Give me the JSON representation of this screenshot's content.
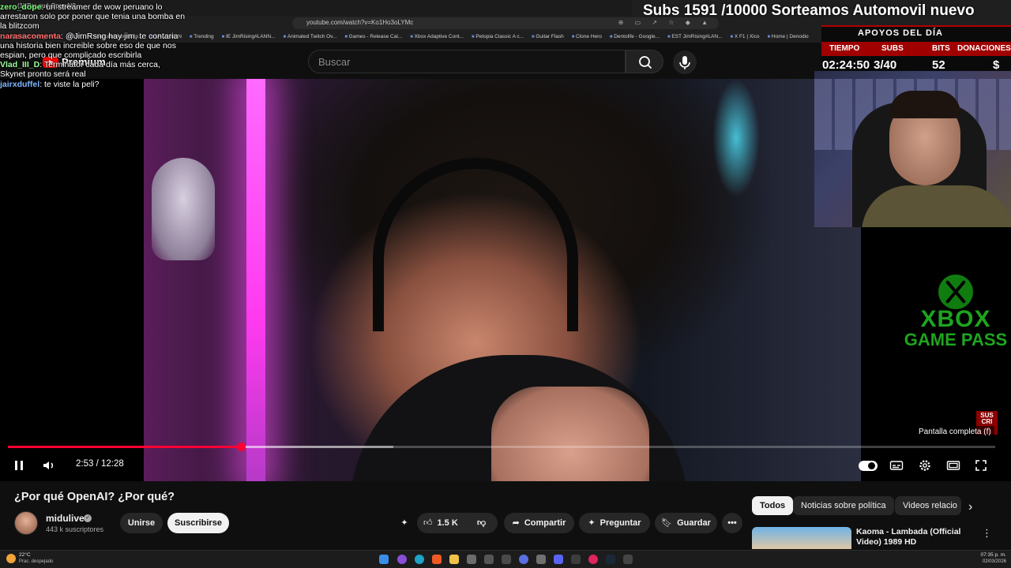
{
  "browser": {
    "tab_title": "(1) Por qué OpenAI?...",
    "url": "youtube.com/watch?v=Ko1Ho3oLYMc",
    "bookmarks": [
      "(1) Nihil Young - Ult...",
      "tryn",
      "Formulario sin título...",
      "LA LEGION",
      "Trending",
      "IE JimRising#LANN...",
      "Animated Twitch Ov...",
      "Games - Release Cal...",
      "Xbox Adaptive Cont...",
      "Petopia Classic A c...",
      "Guitar Flash",
      "Clone Hero",
      "Dentolife - Google...",
      "EST JimRising#LAN...",
      "X F1 | Xico",
      "Home | Denodio"
    ]
  },
  "masthead": {
    "logo_text": "Premium",
    "search_placeholder": "Buscar"
  },
  "stream_overlay": {
    "subs_banner": "Subs 1591 /10000 Sorteamos Automovil nuevo",
    "apoyos_title": "APOYOS DEL DÍA",
    "labels": [
      "TIEMPO",
      "SUBS",
      "BITS",
      "DONACIONES"
    ],
    "values": [
      "02:24:50",
      "3/40",
      "52",
      "$"
    ],
    "sub_badge": "SUS CRI",
    "xbox_line1": "XBOX",
    "xbox_line2": "GAME PASS"
  },
  "chat": [
    {
      "user": "zero_dope",
      "text": "un streamer de wow peruano lo"
    },
    {
      "user": "",
      "text": "arrestaron solo por poner que tenia una bomba en"
    },
    {
      "user": "",
      "text": "la blitzcom"
    },
    {
      "user": "narasacomenta",
      "text": "@JimRsng hay jim, te contaria"
    },
    {
      "user": "",
      "text": "una historia bien increible sobre eso de que nos"
    },
    {
      "user": "",
      "text": "espian, pero que complicado escribirla"
    },
    {
      "user": "Vlad_III_D",
      "text": "Terminator cada día más cerca,"
    },
    {
      "user": "",
      "text": "Skynet pronto será real"
    },
    {
      "user": "jairxduffel",
      "text": "te viste la peli?"
    }
  ],
  "player": {
    "time_current": "2:53",
    "time_total": "12:28",
    "tooltip": "Pantalla completa (f)",
    "progress_fraction": 0.236,
    "buffer_fraction": 0.39
  },
  "video": {
    "title": "¿Por qué OpenAI? ¿Por qué?",
    "channel": "midulive",
    "subscribers": "443 k suscriptores",
    "join_label": "Unirse",
    "subscribe_label": "Suscribirse",
    "likes": "1.5 K",
    "share_label": "Compartir",
    "ask_label": "Preguntar",
    "save_label": "Guardar"
  },
  "chips": [
    "Todos",
    "Noticias sobre política",
    "Videos relacio"
  ],
  "recommendation": {
    "title": "Kaoma - Lambada (Official Video) 1989 HD"
  },
  "taskbar": {
    "temperature": "22°C",
    "weather": "Prac. despejado",
    "time": "07:35 p. m.",
    "date": "02/03/2026"
  },
  "colors": {
    "progress": "#ff0033",
    "brand_red": "#ff0000",
    "xbox_green": "#1ea51e",
    "overlay_red": "#a00000"
  }
}
